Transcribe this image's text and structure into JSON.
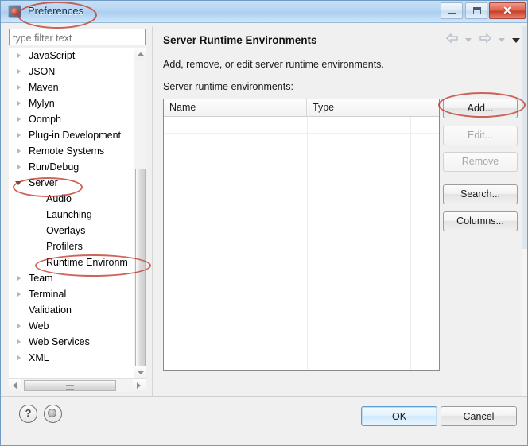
{
  "window": {
    "title": "Preferences",
    "icon": "preferences-app-icon",
    "controls": {
      "minimize": "minimize-icon",
      "maximize": "maximize-icon",
      "close": "✕"
    }
  },
  "sidebar": {
    "filter": {
      "value": "",
      "placeholder": "type filter text"
    },
    "items": [
      {
        "label": "JavaScript",
        "level": 0,
        "arrow": "collapsed"
      },
      {
        "label": "JSON",
        "level": 0,
        "arrow": "collapsed"
      },
      {
        "label": "Maven",
        "level": 0,
        "arrow": "collapsed"
      },
      {
        "label": "Mylyn",
        "level": 0,
        "arrow": "collapsed"
      },
      {
        "label": "Oomph",
        "level": 0,
        "arrow": "collapsed"
      },
      {
        "label": "Plug-in Development",
        "level": 0,
        "arrow": "collapsed"
      },
      {
        "label": "Remote Systems",
        "level": 0,
        "arrow": "collapsed"
      },
      {
        "label": "Run/Debug",
        "level": 0,
        "arrow": "collapsed"
      },
      {
        "label": "Server",
        "level": 0,
        "arrow": "expanded"
      },
      {
        "label": "Audio",
        "level": 1,
        "arrow": "none"
      },
      {
        "label": "Launching",
        "level": 1,
        "arrow": "none"
      },
      {
        "label": "Overlays",
        "level": 1,
        "arrow": "none"
      },
      {
        "label": "Profilers",
        "level": 1,
        "arrow": "none"
      },
      {
        "label": "Runtime Environm",
        "level": 1,
        "arrow": "none"
      },
      {
        "label": "Team",
        "level": 0,
        "arrow": "collapsed"
      },
      {
        "label": "Terminal",
        "level": 0,
        "arrow": "collapsed"
      },
      {
        "label": "Validation",
        "level": 0,
        "arrow": "none"
      },
      {
        "label": "Web",
        "level": 0,
        "arrow": "collapsed"
      },
      {
        "label": "Web Services",
        "level": 0,
        "arrow": "collapsed"
      },
      {
        "label": "XML",
        "level": 0,
        "arrow": "collapsed"
      }
    ]
  },
  "main": {
    "title": "Server Runtime Environments",
    "description": "Add, remove, or edit server runtime environments.",
    "list_label": "Server runtime environments:",
    "nav": {
      "back": "back-arrow-icon",
      "back_menu": "chevron-down-icon",
      "forward": "forward-arrow-icon",
      "forward_menu": "chevron-down-icon",
      "view_menu": "chevron-down-icon"
    },
    "table": {
      "columns": [
        "Name",
        "Type",
        ""
      ],
      "rows": []
    },
    "buttons": [
      {
        "label": "Add...",
        "enabled": true
      },
      {
        "label": "Edit...",
        "enabled": false
      },
      {
        "label": "Remove",
        "enabled": false
      },
      {
        "label": "Search...",
        "enabled": true
      },
      {
        "label": "Columns...",
        "enabled": true
      }
    ]
  },
  "footer": {
    "help_icon": "?",
    "shell_icon": "oomph-icon",
    "ok_label": "OK",
    "cancel_label": "Cancel"
  },
  "annotations": {
    "color": "#c0392b",
    "marks": [
      {
        "target": "Preferences"
      },
      {
        "target": "Server"
      },
      {
        "target": "Runtime Environm"
      },
      {
        "target": "Add..."
      }
    ]
  }
}
